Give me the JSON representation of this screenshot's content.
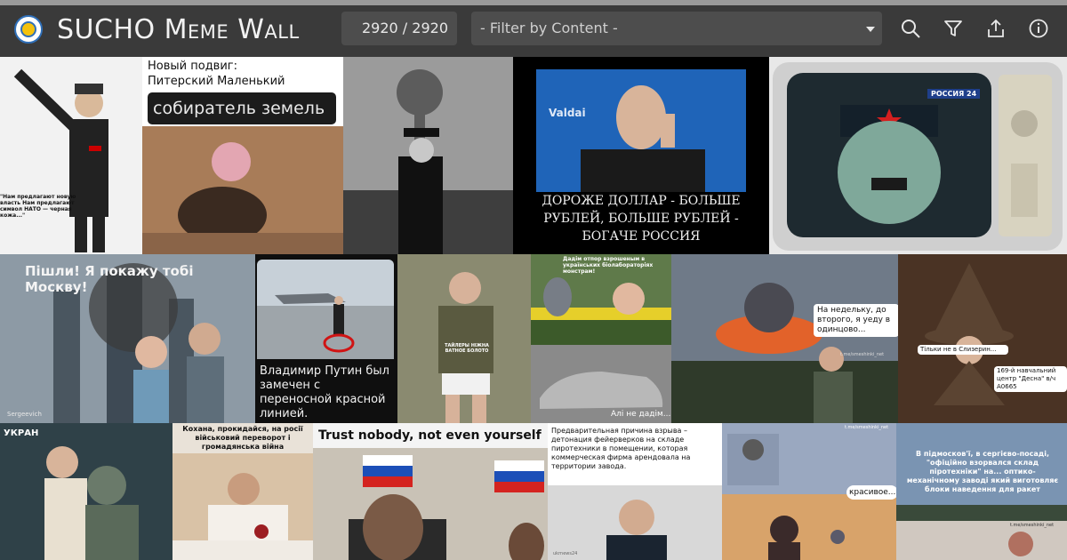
{
  "app": {
    "title": "SUCHO Meme Wall",
    "logo_icon": "sucho-logo-icon"
  },
  "counter": {
    "value": "2920 / 2920"
  },
  "filter": {
    "placeholder": "- Filter by Content -"
  },
  "toolbar": {
    "icons": [
      "search-icon",
      "filter-icon",
      "share-icon",
      "info-icon"
    ]
  },
  "memes": {
    "m1": {
      "caption": "\"Нам предлагают новую власть Нам предлагают символ НАТО — черная кожа...\""
    },
    "m2": {
      "line1": "Новый подвиг:",
      "line2": "Питерский Маленький",
      "badge": "собиратель земель"
    },
    "m4": {
      "caption": "ДОРОЖЕ ДОЛЛАР - БОЛЬШЕ РУБЛЕЙ, БОЛЬШЕ РУБЛЕЙ - БОГАЧЕ РОССИЯ",
      "source": "Valdai"
    },
    "m5": {
      "channel": "РОССИЯ 24"
    },
    "m6": {
      "caption": "Пішли! Я покажу тобі Москву!",
      "watermark": "Sergeevich"
    },
    "m7": {
      "caption": "Владимир Путин был замечен с переносной красной линией."
    },
    "m8": {
      "patch": "ТАЙЛЕРЫ НІЖНА ВАТНОЕ БОЛОТО"
    },
    "m9": {
      "top": "Дадім отпор взрошеным в українських біолабораторіях монстрам!",
      "bottom": "Алі не дадім..."
    },
    "m10": {
      "bubble": "На недельку, до второго, я уеду в одинцово...",
      "watermark": "t.me/smeshinki_net"
    },
    "m11": {
      "bubble1": "Тільки не в Слизерин...",
      "bubble2": "169-й навчальний центр \"Десна\" в/ч А0665"
    },
    "m12": {
      "tag": "УКРАН"
    },
    "m13": {
      "caption": "Кохана, прокидайся, на росії військовий переворот і громадянська війна"
    },
    "m14": {
      "caption": "Trust nobody, not even yourself"
    },
    "m15": {
      "caption": "Предварительная причина взрыва – детонация фейерверков на складе пиротехники в помещении, которая коммерческая фирма арендовала на территории завода.",
      "watermark": "ukrnews24"
    },
    "m16": {
      "bubble": "красивое...",
      "watermark": "t.me/smeshinki_net"
    },
    "m17": {
      "caption": "В підмосков'ї, в сергієво-посаді, \"офіційно взорвался склад піротехніки\" на... оптико-механічному заводі який виготовляє блоки наведення для ракет",
      "watermark": "t.me/smeshinki_net"
    }
  },
  "colors": {
    "header": "#3a3a3a",
    "field": "#4d4d4d",
    "text": "#f2f2f2",
    "accent": "#2f6fb8"
  }
}
